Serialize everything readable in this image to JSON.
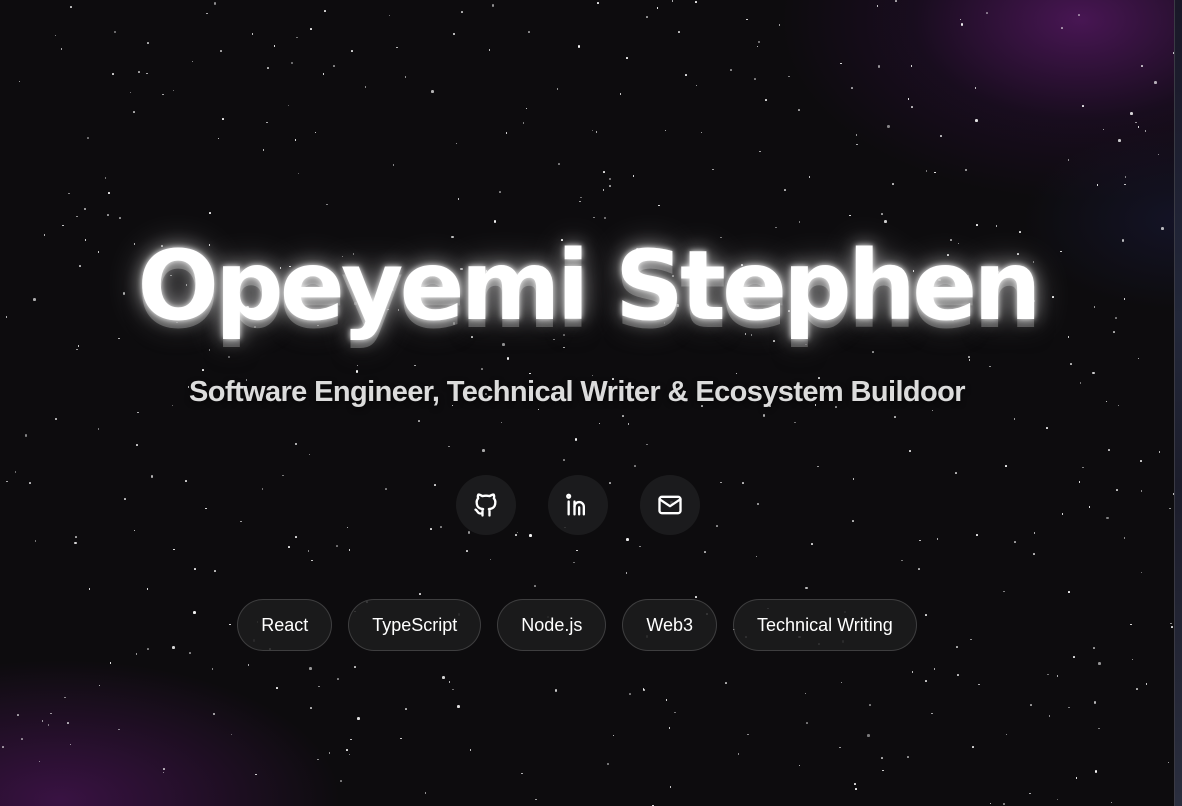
{
  "hero": {
    "name": "Opeyemi Stephen",
    "subtitle": "Software Engineer, Technical Writer & Ecosystem Buildoor"
  },
  "social_links": [
    {
      "icon": "github-icon",
      "label": "GitHub"
    },
    {
      "icon": "linkedin-icon",
      "label": "LinkedIn"
    },
    {
      "icon": "mail-icon",
      "label": "Email"
    }
  ],
  "tags": [
    "React",
    "TypeScript",
    "Node.js",
    "Web3",
    "Technical Writing"
  ],
  "colors": {
    "background": "#0d0c0e",
    "accent_glow": "#7a1e8c",
    "text": "#ffffff",
    "subtitle": "#dcdcdc"
  }
}
